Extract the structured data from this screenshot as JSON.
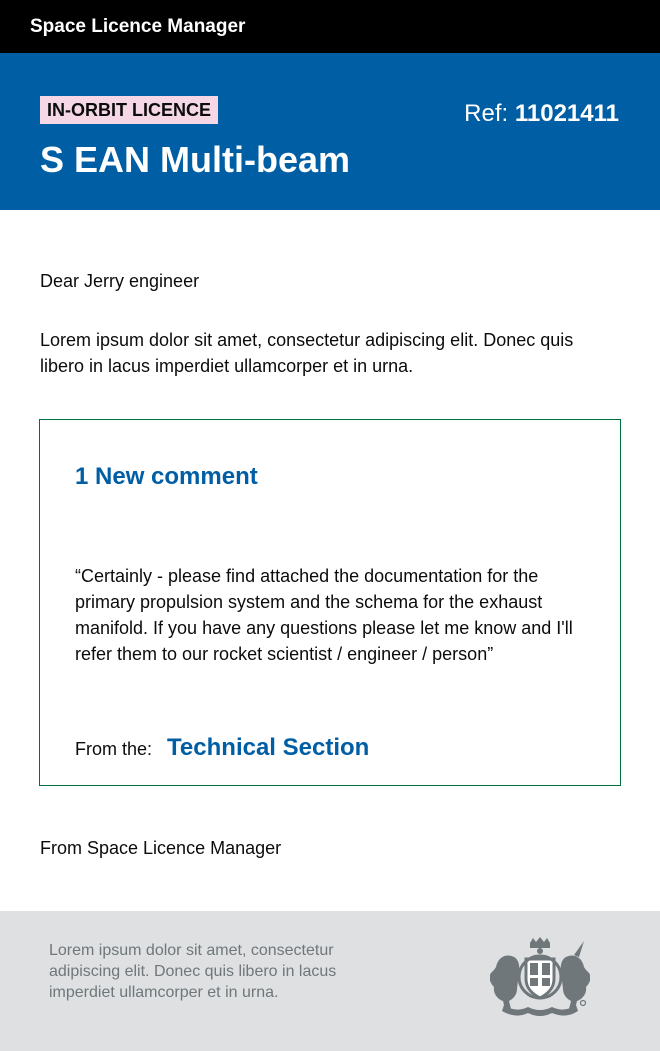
{
  "app": {
    "title": "Space Licence Manager"
  },
  "hero": {
    "tag": "IN-ORBIT LICENCE",
    "ref_label": "Ref:",
    "ref_number": "11021411",
    "title": "S EAN Multi-beam"
  },
  "body": {
    "greeting": "Dear Jerry engineer",
    "intro": "Lorem ipsum dolor sit amet, consectetur adipiscing elit. Donec quis libero in lacus imperdiet ullamcorper et in urna.",
    "signoff": "From Space Licence Manager"
  },
  "comment": {
    "heading": "1 New comment",
    "text": "“Certainly - please find attached the documentation for the primary propulsion system and the schema for the exhaust manifold. If you have any questions please let me know and I'll refer them to our rocket scientist / engineer / person”",
    "from_label": "From the:",
    "from_section": "Technical Section"
  },
  "footer": {
    "text": "Lorem ipsum dolor sit amet, consectetur adipiscing elit. Donec quis libero in lacus imperdiet ullamcorper et in urna.",
    "crest_icon": "royal-coat-of-arms-icon"
  },
  "colors": {
    "header_bg": "#000000",
    "hero_bg": "#005ea5",
    "tag_bg": "#f6d7e5",
    "accent_blue": "#005ea5",
    "comment_border": "#00703c",
    "footer_bg": "#dee0e2",
    "footer_text": "#6f777b"
  }
}
